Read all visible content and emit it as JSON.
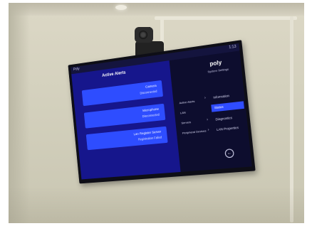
{
  "screen": {
    "status": {
      "left": "Poly",
      "time": "1:13"
    },
    "main": {
      "title": "Active Alerts",
      "alerts": [
        {
          "title": "Camera",
          "status": "Disconnected"
        },
        {
          "title": "Microphone",
          "status": "Disconnected"
        },
        {
          "title": "Lan Register Server",
          "status": "Registration Failed"
        }
      ]
    },
    "side": {
      "logo": "poly",
      "subtitle": "System Settings",
      "mid_items": [
        "Active Alerts",
        "LAN",
        "Servers",
        "Peripheral Devices"
      ],
      "nav": [
        {
          "label": "Information",
          "chevron": "›"
        },
        {
          "label": "Status",
          "chevron": ""
        },
        {
          "label": "Diagnostics",
          "chevron": "›"
        },
        {
          "label": "LAN Properties",
          "chevron": "›"
        }
      ],
      "back_glyph": "←"
    }
  }
}
